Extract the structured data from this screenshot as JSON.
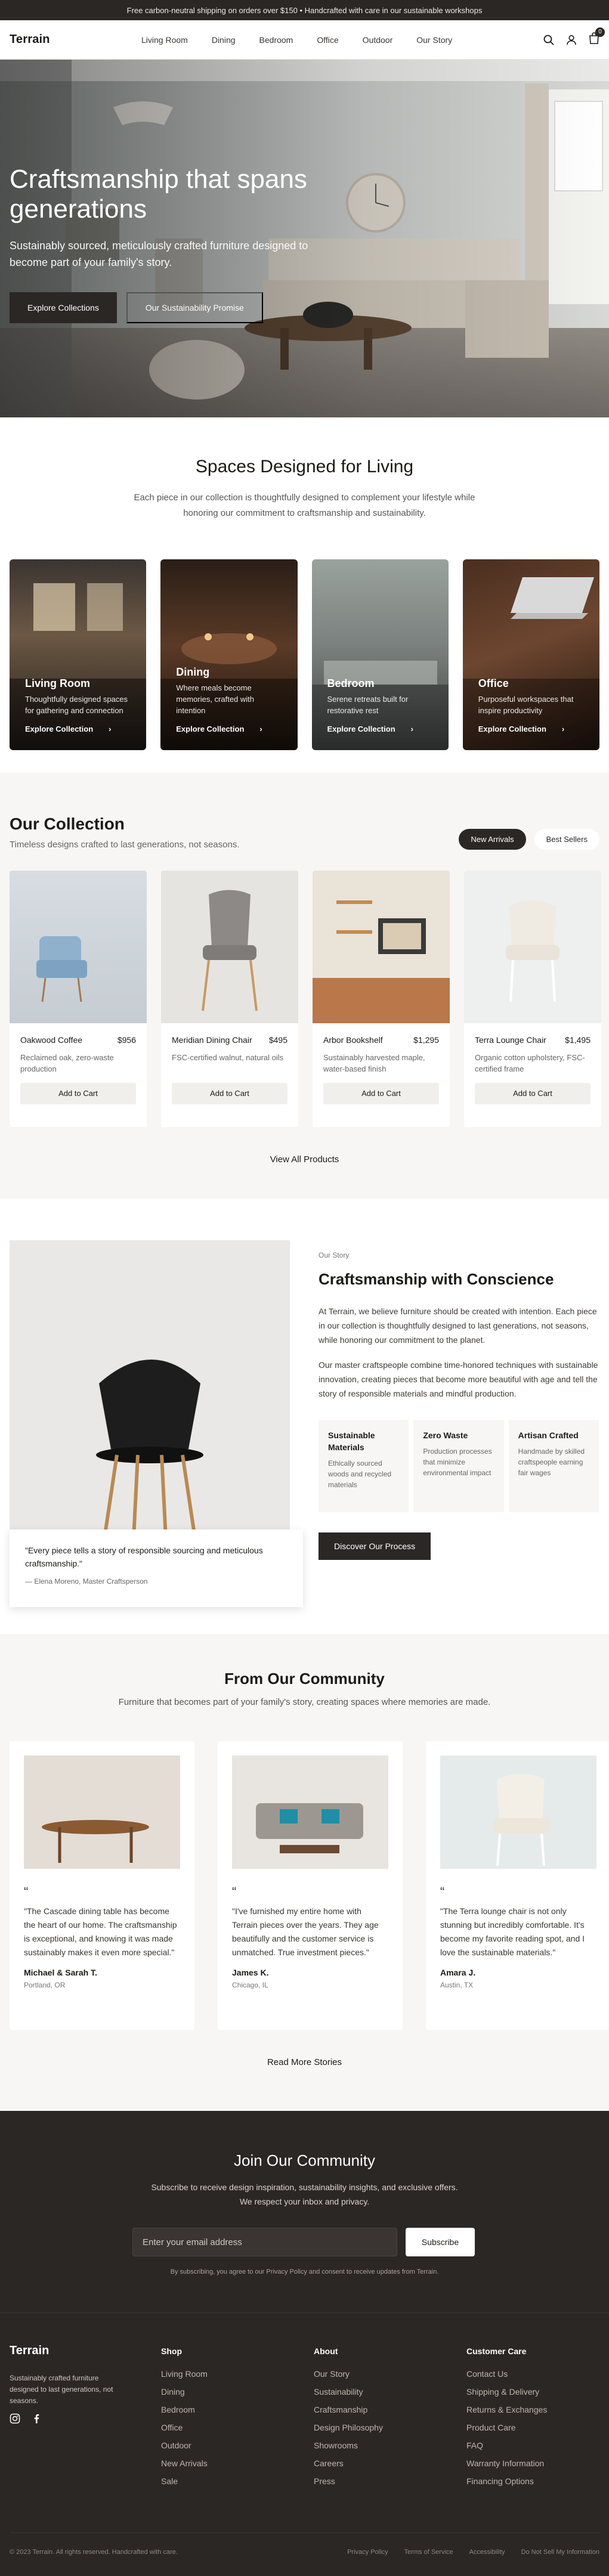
{
  "announcement": "Free carbon-neutral shipping on orders over $150 • Handcrafted with care in our sustainable workshops",
  "header": {
    "logo": "Terrain",
    "nav": [
      "Living Room",
      "Dining",
      "Bedroom",
      "Office",
      "Outdoor",
      "Our Story"
    ],
    "cart_count": "0"
  },
  "hero": {
    "title": "Craftsmanship that spans generations",
    "subtitle": "Sustainably sourced, meticulously crafted furniture designed to become part of your family's story.",
    "primary_cta": "Explore Collections",
    "secondary_cta": "Our Sustainability Promise"
  },
  "spaces": {
    "title": "Spaces Designed for Living",
    "subtitle": "Each piece in our collection is thoughtfully designed to complement your lifestyle while honoring our commitment to craftsmanship and sustainability.",
    "cards": [
      {
        "title": "Living Room",
        "desc": "Thoughtfully designed spaces for gathering and connection",
        "link": "Explore Collection"
      },
      {
        "title": "Dining",
        "desc": "Where meals become memories, crafted with intention",
        "link": "Explore Collection"
      },
      {
        "title": "Bedroom",
        "desc": "Serene retreats built for restorative rest",
        "link": "Explore Collection"
      },
      {
        "title": "Office",
        "desc": "Purposeful workspaces that inspire productivity",
        "link": "Explore Collection"
      }
    ]
  },
  "collection": {
    "title": "Our Collection",
    "subtitle": "Timeless designs crafted to last generations, not seasons.",
    "tabs": [
      "New Arrivals",
      "Best Sellers"
    ],
    "products": [
      {
        "name": "Oakwood Coffee",
        "price": "$956",
        "desc": "Reclaimed oak, zero-waste production",
        "cta": "Add to Cart"
      },
      {
        "name": "Meridian Dining Chair",
        "price": "$495",
        "desc": "FSC-certified walnut, natural oils",
        "cta": "Add to Cart"
      },
      {
        "name": "Arbor Bookshelf",
        "price": "$1,295",
        "desc": "Sustainably harvested maple, water-based finish",
        "cta": "Add to Cart"
      },
      {
        "name": "Terra Lounge Chair",
        "price": "$1,495",
        "desc": "Organic cotton upholstery, FSC-certified frame",
        "cta": "Add to Cart"
      }
    ],
    "view_all": "View All Products"
  },
  "story": {
    "eyebrow": "Our Story",
    "title": "Craftsmanship with Conscience",
    "p1": "At Terrain, we believe furniture should be created with intention. Each piece in our collection is thoughtfully designed to last generations, not seasons, while honoring our commitment to the planet.",
    "p2": "Our master craftspeople combine time-honored techniques with sustainable innovation, creating pieces that become more beautiful with age and tell the story of responsible materials and mindful production.",
    "features": [
      {
        "title": "Sustainable Materials",
        "desc": "Ethically sourced woods and recycled materials"
      },
      {
        "title": "Zero Waste",
        "desc": "Production processes that minimize environmental impact"
      },
      {
        "title": "Artisan Crafted",
        "desc": "Handmade by skilled craftspeople earning fair wages"
      }
    ],
    "cta": "Discover Our Process",
    "quote": "\"Every piece tells a story of responsible sourcing and meticulous craftsmanship.\"",
    "quote_author": "— Elena Moreno, Master Craftsperson"
  },
  "community": {
    "title": "From Our Community",
    "subtitle": "Furniture that becomes part of your family's story, creating spaces where memories are made.",
    "testimonials": [
      {
        "quote": "\"The Cascade dining table has become the heart of our home. The craftsmanship is exceptional, and knowing it was made sustainably makes it even more special.\"",
        "name": "Michael & Sarah T.",
        "location": "Portland, OR"
      },
      {
        "quote": "\"I've furnished my entire home with Terrain pieces over the years. They age beautifully and the customer service is unmatched. True investment pieces.\"",
        "name": "James K.",
        "location": "Chicago, IL"
      },
      {
        "quote": "\"The Terra lounge chair is not only stunning but incredibly comfortable. It's become my favorite reading spot, and I love the sustainable materials.\"",
        "name": "Amara J.",
        "location": "Austin, TX"
      }
    ],
    "read_more": "Read More Stories"
  },
  "newsletter": {
    "title": "Join Our Community",
    "subtitle": "Subscribe to receive design inspiration, sustainability insights, and exclusive offers. We respect your inbox and privacy.",
    "placeholder": "Enter your email address",
    "cta": "Subscribe",
    "note": "By subscribing, you agree to our Privacy Policy and consent to receive updates from Terrain."
  },
  "footer": {
    "logo": "Terrain",
    "desc": "Sustainably crafted furniture designed to last generations, not seasons.",
    "cols": [
      {
        "title": "Shop",
        "links": [
          "Living Room",
          "Dining",
          "Bedroom",
          "Office",
          "Outdoor",
          "New Arrivals",
          "Sale"
        ]
      },
      {
        "title": "About",
        "links": [
          "Our Story",
          "Sustainability",
          "Craftsmanship",
          "Design Philosophy",
          "Showrooms",
          "Careers",
          "Press"
        ]
      },
      {
        "title": "Customer Care",
        "links": [
          "Contact Us",
          "Shipping & Delivery",
          "Returns & Exchanges",
          "Product Care",
          "FAQ",
          "Warranty Information",
          "Financing Options"
        ]
      }
    ],
    "copyright": "© 2023 Terrain. All rights reserved. Handcrafted with care.",
    "legal": [
      "Privacy Policy",
      "Terms of Service",
      "Accessibility",
      "Do Not Sell My Information"
    ]
  },
  "icons": {
    "search": "search-icon",
    "user": "user-icon",
    "bag": "shopping-bag-icon",
    "instagram": "instagram-icon",
    "facebook": "facebook-icon",
    "arrow": "chevron-right-icon"
  }
}
